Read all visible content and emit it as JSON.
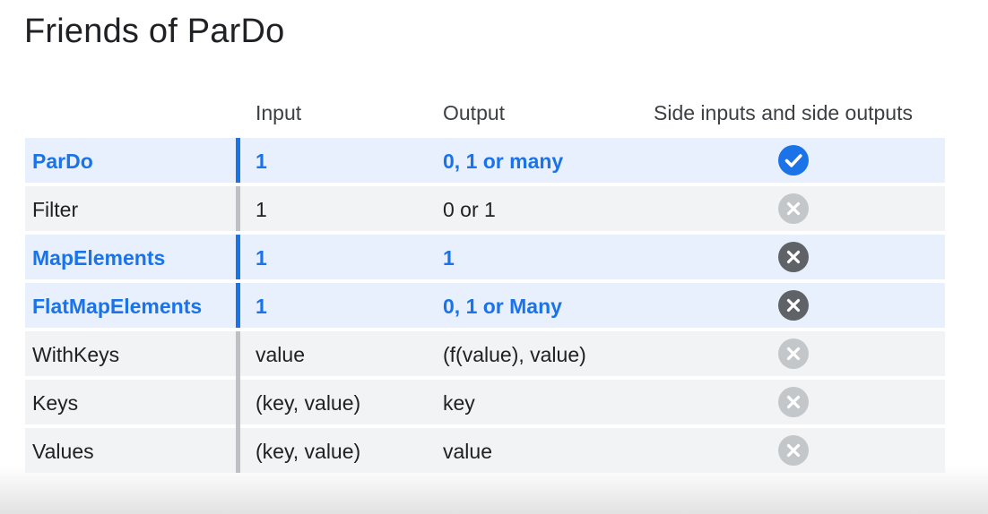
{
  "title": "Friends of ParDo",
  "headers": {
    "name": "",
    "input": "Input",
    "output": "Output",
    "side": "Side inputs and side outputs"
  },
  "colors": {
    "accent": "#1a73e8",
    "highlight_row": "#e8f0fe",
    "plain_row": "#f1f3f4",
    "check": "#1a73e8",
    "cross_light": "#bdc1c6",
    "cross_dark": "#5f6368"
  },
  "rows": [
    {
      "name": "ParDo",
      "input": "1",
      "output": "0, 1 or many",
      "highlighted": true,
      "side": "check-icon"
    },
    {
      "name": "Filter",
      "input": "1",
      "output": "0 or 1",
      "highlighted": false,
      "side": "cross-light-icon"
    },
    {
      "name": "MapElements",
      "input": "1",
      "output": "1",
      "highlighted": true,
      "side": "cross-dark-icon"
    },
    {
      "name": "FlatMapElements",
      "input": "1",
      "output": "0, 1 or Many",
      "highlighted": true,
      "side": "cross-dark-icon"
    },
    {
      "name": "WithKeys",
      "input": "value",
      "output": "(f(value), value)",
      "highlighted": false,
      "side": "cross-light-icon"
    },
    {
      "name": "Keys",
      "input": "(key, value)",
      "output": "key",
      "highlighted": false,
      "side": "cross-light-icon"
    },
    {
      "name": "Values",
      "input": "(key, value)",
      "output": "value",
      "highlighted": false,
      "side": "cross-light-icon"
    }
  ]
}
